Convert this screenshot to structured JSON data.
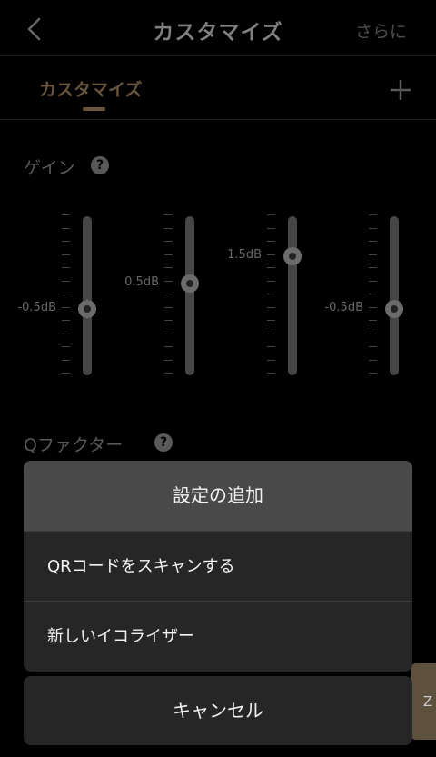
{
  "nav": {
    "title": "カスタマイズ",
    "more_label": "さらに"
  },
  "tabs": [
    {
      "label": "カスタマイズ",
      "active": true
    }
  ],
  "gain": {
    "label": "ゲイン",
    "help": "?"
  },
  "bands": [
    {
      "value_label": "-0.5dB",
      "level": 0.58
    },
    {
      "value_label": "0.5dB",
      "level": 0.42
    },
    {
      "value_label": "1.5dB",
      "level": 0.25
    },
    {
      "value_label": "-0.5dB",
      "level": 0.58
    }
  ],
  "qfactor": {
    "label": "Qファクター",
    "help": "?"
  },
  "sheet": {
    "title": "設定の追加",
    "items": [
      "QRコードをスキャンする",
      "新しいイコライザー"
    ],
    "cancel_label": "キャンセル"
  },
  "side_tab": {
    "label": "Z"
  },
  "colors": {
    "accent": "#8a7352",
    "background": "#000000",
    "sheet": "#262626",
    "sheet_header": "#494949"
  }
}
